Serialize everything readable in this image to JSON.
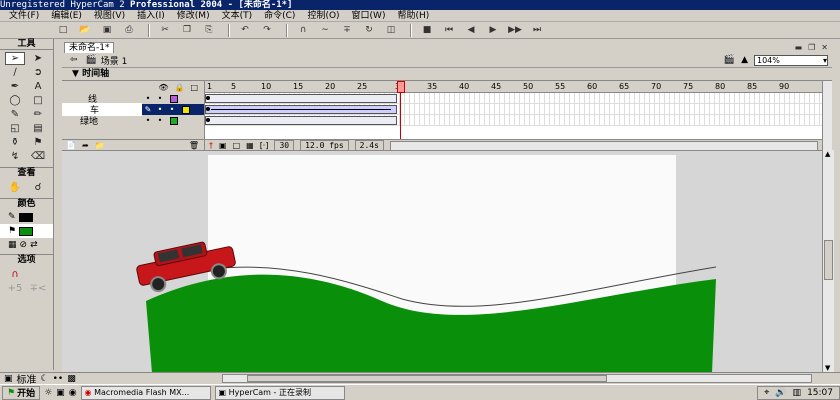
{
  "window": {
    "title_left": "Unregistered HyperCam 2",
    "title_right": "Professional 2004 - [未命名-1*]"
  },
  "menu": [
    "文件(F)",
    "编辑(E)",
    "视图(V)",
    "插入(I)",
    "修改(M)",
    "文本(T)",
    "命令(C)",
    "控制(O)",
    "窗口(W)",
    "帮助(H)"
  ],
  "toolbar": {
    "icons": [
      "new-file-icon",
      "open-icon",
      "save-icon",
      "print-icon",
      "cut-icon",
      "copy-icon",
      "paste-icon",
      "undo-icon",
      "redo-icon",
      "snap-icon",
      "smooth-icon",
      "straighten-icon",
      "rotate-icon",
      "scale-icon"
    ],
    "playback_icons": [
      "stop-icon",
      "rewind-icon",
      "step-back-icon",
      "play-icon",
      "step-forward-icon",
      "end-icon"
    ]
  },
  "tools_panel": {
    "header": "工具",
    "view_label": "查看",
    "colors_label": "颜色",
    "options_label": "选项"
  },
  "document": {
    "tab_label": "未命名-1*",
    "scene_label": "场景 1",
    "zoom": "104%"
  },
  "timeline": {
    "header": "时间轴",
    "ruler_ticks": [
      "1",
      "5",
      "10",
      "15",
      "20",
      "25",
      "30",
      "35",
      "40",
      "45",
      "50",
      "55",
      "60",
      "65",
      "70",
      "75",
      "80",
      "85",
      "90"
    ],
    "layers": [
      {
        "name": "线",
        "color": "#b85cd6",
        "selected": false
      },
      {
        "name": "车",
        "color": "#e8e800",
        "selected": true
      },
      {
        "name": "绿地",
        "color": "#22aa22",
        "selected": false
      }
    ],
    "current_frame": "30",
    "frame_rate": "12.0 fps",
    "elapsed": "2.4s"
  },
  "props_bar": {
    "label": "标准"
  },
  "taskbar": {
    "start_label": "开始",
    "tasks": [
      {
        "label": "Macromedia Flash MX...",
        "active": false
      },
      {
        "label": "HyperCam - 正在录制",
        "active": false
      }
    ],
    "clock": "15:07"
  },
  "colors": {
    "titlebar": "#0a246a",
    "grass": "#0a8f0a",
    "car_body": "#c8171b",
    "stage_bg": "#fafafa"
  }
}
